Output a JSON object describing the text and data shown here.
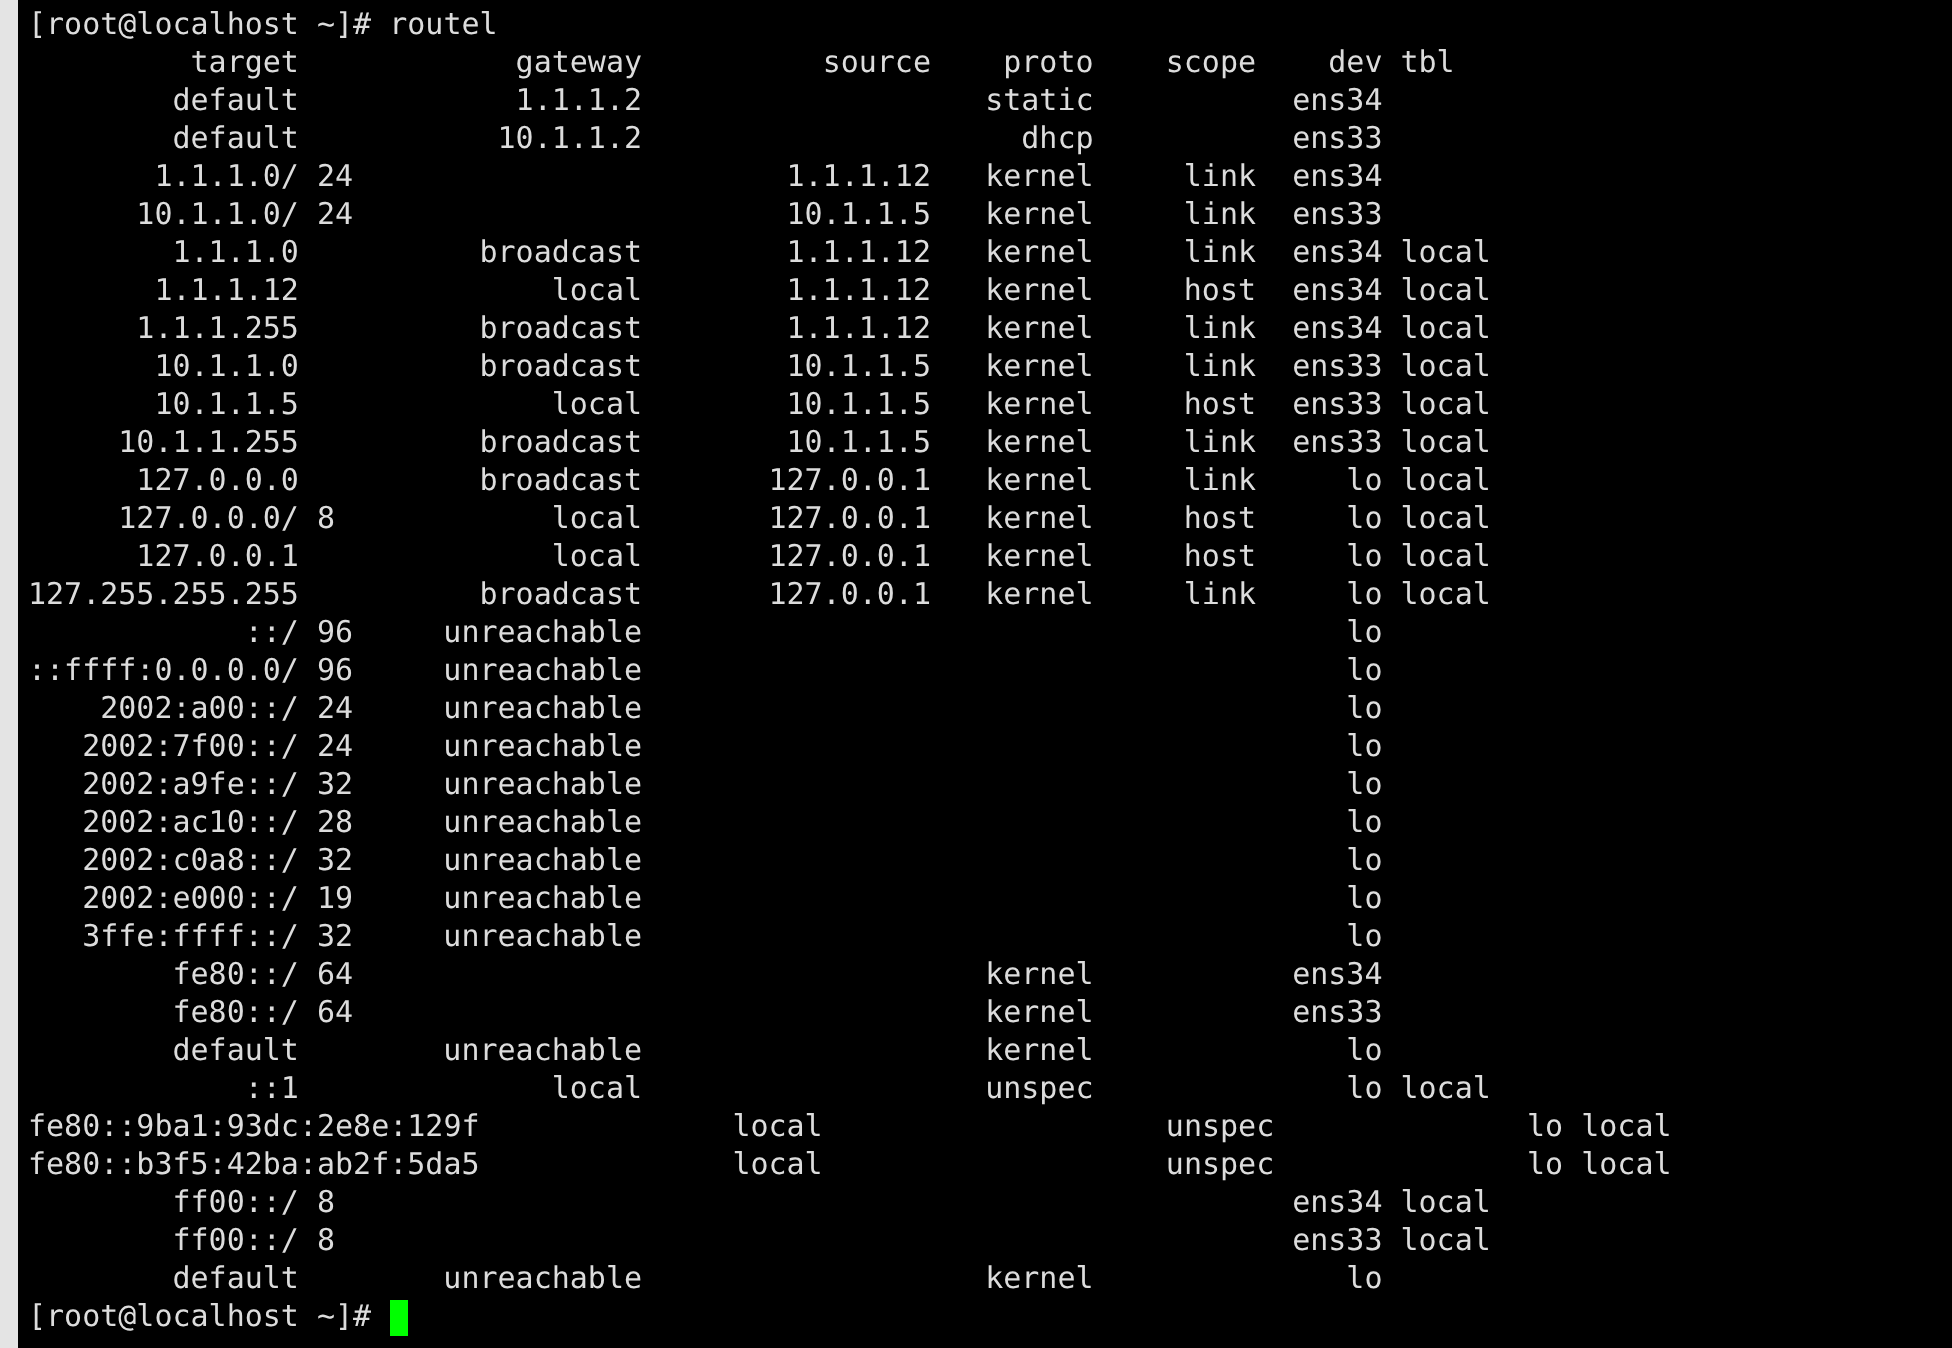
{
  "terminal": {
    "command_line": {
      "prompt": "[root@localhost ~]#",
      "command": "routel"
    },
    "rows": [
      {
        "kind": "header",
        "target": "target",
        "gateway": "gateway",
        "source": "source",
        "proto": "proto",
        "scope": "scope",
        "dev": "dev",
        "table": "tbl"
      },
      {
        "kind": "route",
        "target": "default",
        "gateway": "1.1.1.2",
        "proto": "static",
        "dev": "ens34"
      },
      {
        "kind": "route",
        "target": "default",
        "gateway": "10.1.1.2",
        "proto": "dhcp",
        "dev": "ens33"
      },
      {
        "kind": "route",
        "target": "1.1.1.0/",
        "prefix": "24",
        "source": "1.1.1.12",
        "proto": "kernel",
        "scope": "link",
        "dev": "ens34"
      },
      {
        "kind": "route",
        "target": "10.1.1.0/",
        "prefix": "24",
        "source": "10.1.1.5",
        "proto": "kernel",
        "scope": "link",
        "dev": "ens33"
      },
      {
        "kind": "route",
        "target": "1.1.1.0",
        "gateway": "broadcast",
        "source": "1.1.1.12",
        "proto": "kernel",
        "scope": "link",
        "dev": "ens34",
        "table": "local"
      },
      {
        "kind": "route",
        "target": "1.1.1.12",
        "gateway": "local",
        "source": "1.1.1.12",
        "proto": "kernel",
        "scope": "host",
        "dev": "ens34",
        "table": "local"
      },
      {
        "kind": "route",
        "target": "1.1.1.255",
        "gateway": "broadcast",
        "source": "1.1.1.12",
        "proto": "kernel",
        "scope": "link",
        "dev": "ens34",
        "table": "local"
      },
      {
        "kind": "route",
        "target": "10.1.1.0",
        "gateway": "broadcast",
        "source": "10.1.1.5",
        "proto": "kernel",
        "scope": "link",
        "dev": "ens33",
        "table": "local"
      },
      {
        "kind": "route",
        "target": "10.1.1.5",
        "gateway": "local",
        "source": "10.1.1.5",
        "proto": "kernel",
        "scope": "host",
        "dev": "ens33",
        "table": "local"
      },
      {
        "kind": "route",
        "target": "10.1.1.255",
        "gateway": "broadcast",
        "source": "10.1.1.5",
        "proto": "kernel",
        "scope": "link",
        "dev": "ens33",
        "table": "local"
      },
      {
        "kind": "route",
        "target": "127.0.0.0",
        "gateway": "broadcast",
        "source": "127.0.0.1",
        "proto": "kernel",
        "scope": "link",
        "dev": "lo",
        "table": "local"
      },
      {
        "kind": "route",
        "target": "127.0.0.0/",
        "prefix": "8",
        "gateway": "local",
        "source": "127.0.0.1",
        "proto": "kernel",
        "scope": "host",
        "dev": "lo",
        "table": "local"
      },
      {
        "kind": "route",
        "target": "127.0.0.1",
        "gateway": "local",
        "source": "127.0.0.1",
        "proto": "kernel",
        "scope": "host",
        "dev": "lo",
        "table": "local"
      },
      {
        "kind": "route",
        "target": "127.255.255.255",
        "gateway": "broadcast",
        "source": "127.0.0.1",
        "proto": "kernel",
        "scope": "link",
        "dev": "lo",
        "table": "local"
      },
      {
        "kind": "route",
        "target": "::/",
        "prefix": "96",
        "gateway": "unreachable",
        "dev": "lo"
      },
      {
        "kind": "route",
        "target": "::ffff:0.0.0.0/",
        "prefix": "96",
        "gateway": "unreachable",
        "dev": "lo"
      },
      {
        "kind": "route",
        "target": "2002:a00::/",
        "prefix": "24",
        "gateway": "unreachable",
        "dev": "lo"
      },
      {
        "kind": "route",
        "target": "2002:7f00::/",
        "prefix": "24",
        "gateway": "unreachable",
        "dev": "lo"
      },
      {
        "kind": "route",
        "target": "2002:a9fe::/",
        "prefix": "32",
        "gateway": "unreachable",
        "dev": "lo"
      },
      {
        "kind": "route",
        "target": "2002:ac10::/",
        "prefix": "28",
        "gateway": "unreachable",
        "dev": "lo"
      },
      {
        "kind": "route",
        "target": "2002:c0a8::/",
        "prefix": "32",
        "gateway": "unreachable",
        "dev": "lo"
      },
      {
        "kind": "route",
        "target": "2002:e000::/",
        "prefix": "19",
        "gateway": "unreachable",
        "dev": "lo"
      },
      {
        "kind": "route",
        "target": "3ffe:ffff::/",
        "prefix": "32",
        "gateway": "unreachable",
        "dev": "lo"
      },
      {
        "kind": "route",
        "target": "fe80::/",
        "prefix": "64",
        "proto": "kernel",
        "dev": "ens34"
      },
      {
        "kind": "route",
        "target": "fe80::/",
        "prefix": "64",
        "proto": "kernel",
        "dev": "ens33"
      },
      {
        "kind": "route",
        "target": "default",
        "gateway": "unreachable",
        "proto": "kernel",
        "dev": "lo"
      },
      {
        "kind": "route",
        "target": "::1",
        "gateway": "local",
        "proto": "unspec",
        "dev": "lo",
        "table": "local"
      },
      {
        "kind": "wide",
        "target": "fe80::9ba1:93dc:2e8e:129f",
        "gateway": "local",
        "proto": "unspec",
        "dev": "lo",
        "table": "local"
      },
      {
        "kind": "wide",
        "target": "fe80::b3f5:42ba:ab2f:5da5",
        "gateway": "local",
        "proto": "unspec",
        "dev": "lo",
        "table": "local"
      },
      {
        "kind": "route",
        "target": "ff00::/",
        "prefix": "8",
        "dev": "ens34",
        "table": "local"
      },
      {
        "kind": "route",
        "target": "ff00::/",
        "prefix": "8",
        "dev": "ens33",
        "table": "local"
      },
      {
        "kind": "route",
        "target": "default",
        "gateway": "unreachable",
        "proto": "kernel",
        "dev": "lo"
      }
    ],
    "prompt_line": {
      "prompt": "[root@localhost ~]#"
    }
  }
}
